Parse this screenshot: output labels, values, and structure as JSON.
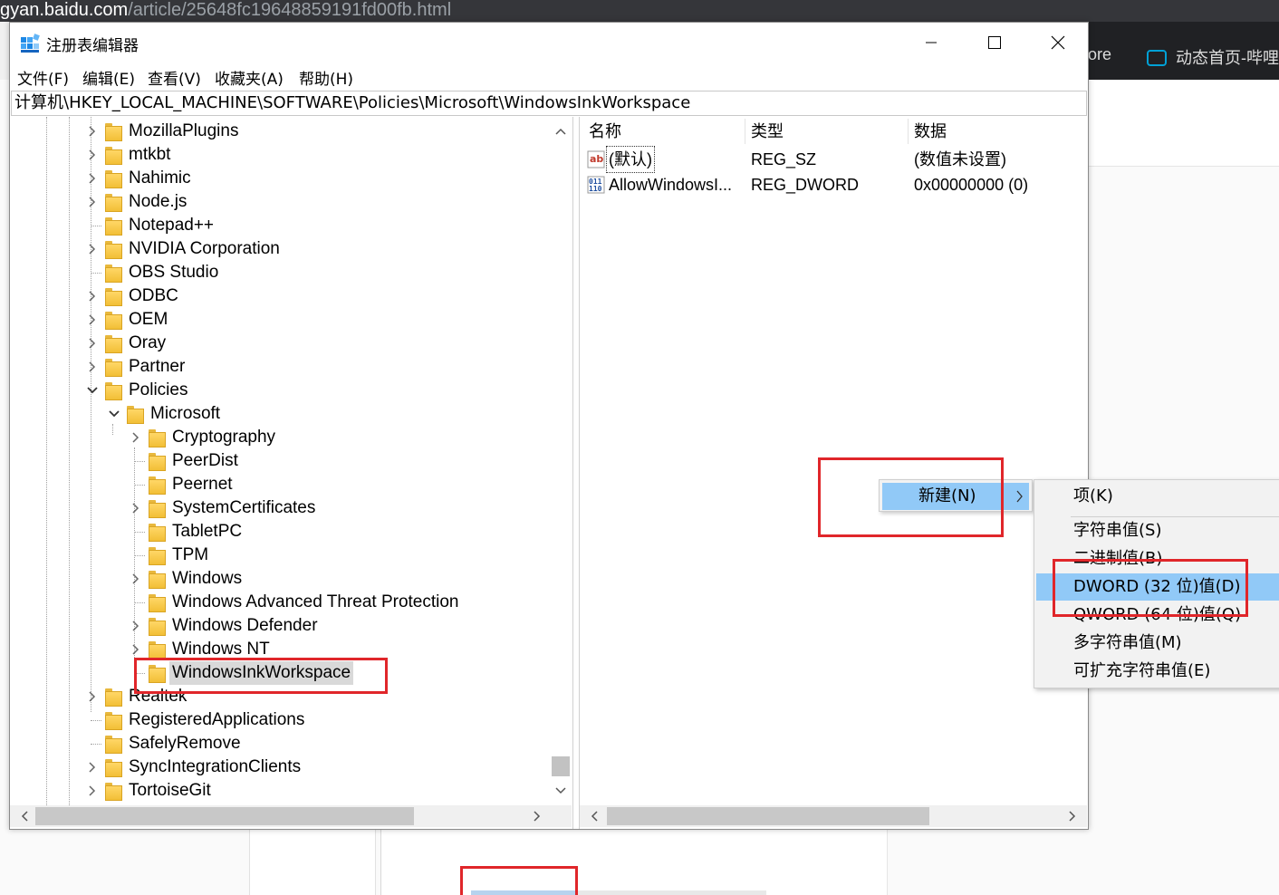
{
  "browser": {
    "url_host": "gyan.baidu.com",
    "url_path": "/article/25648fc19648859191fd00fb.html",
    "tab_store": "Store",
    "tab_bilibili": "动态首页-哔哩"
  },
  "window": {
    "title": "注册表编辑器"
  },
  "menu": [
    "文件(F)",
    "编辑(E)",
    "查看(V)",
    "收藏夹(A)",
    "帮助(H)"
  ],
  "address": "计算机\\HKEY_LOCAL_MACHINE\\SOFTWARE\\Policies\\Microsoft\\WindowsInkWorkspace",
  "tree": {
    "items": [
      {
        "label": "MozillaPlugins"
      },
      {
        "label": "mtkbt"
      },
      {
        "label": "Nahimic"
      },
      {
        "label": "Node.js"
      },
      {
        "label": "Notepad++"
      },
      {
        "label": "NVIDIA Corporation"
      },
      {
        "label": "OBS Studio"
      },
      {
        "label": "ODBC"
      },
      {
        "label": "OEM"
      },
      {
        "label": "Oray"
      },
      {
        "label": "Partner"
      },
      {
        "label": "Policies"
      },
      {
        "label": "Microsoft"
      },
      {
        "label": "Cryptography"
      },
      {
        "label": "PeerDist"
      },
      {
        "label": "Peernet"
      },
      {
        "label": "SystemCertificates"
      },
      {
        "label": "TabletPC"
      },
      {
        "label": "TPM"
      },
      {
        "label": "Windows"
      },
      {
        "label": "Windows Advanced Threat Protection"
      },
      {
        "label": "Windows Defender"
      },
      {
        "label": "Windows NT"
      },
      {
        "label": "WindowsInkWorkspace"
      },
      {
        "label": "Realtek"
      },
      {
        "label": "RegisteredApplications"
      },
      {
        "label": "SafelyRemove"
      },
      {
        "label": "SyncIntegrationClients"
      },
      {
        "label": "TortoiseGit"
      }
    ]
  },
  "values": {
    "headers": {
      "name": "名称",
      "type": "类型",
      "data": "数据"
    },
    "rows": [
      {
        "name": "(默认)",
        "type": "REG_SZ",
        "data": "(数值未设置)",
        "icon": "string-value-icon"
      },
      {
        "name": "AllowWindowsI...",
        "type": "REG_DWORD",
        "data": "0x00000000 (0)",
        "icon": "binary-value-icon"
      }
    ]
  },
  "context_menu": {
    "new_label": "新建(N)"
  },
  "submenu": {
    "items": [
      "项(K)",
      "字符串值(S)",
      "二进制值(B)",
      "DWORD (32 位)值(D)",
      "QWORD (64 位)值(Q)",
      "多字符串值(M)",
      "可扩充字符串值(E)"
    ],
    "highlighted": "DWORD (32 位)值(D)"
  },
  "colors": {
    "highlight": "#91c9f7",
    "annotation_red": "#e0262a",
    "folder": "#f2bf36"
  }
}
